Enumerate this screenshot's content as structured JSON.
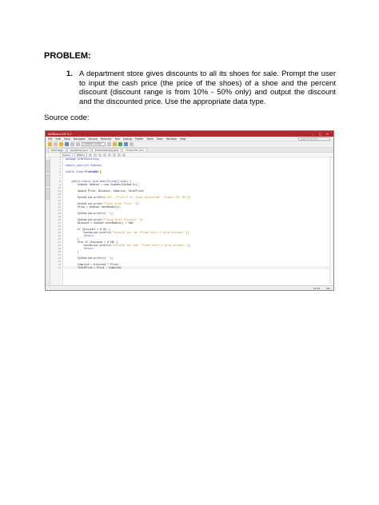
{
  "document": {
    "heading": "PROBLEM:",
    "problem_number": "1.",
    "problem_text": "A department store gives discounts to all its shoes for sale.  Prompt the user to input the cash price (the price of the shoes) of a shoe and the percent discount (discount range is from 10% - 50% only) and output the discount and the discounted price. Use the appropriate data type.",
    "source_label": "Source code:"
  },
  "ide": {
    "title": "NetBeans IDE 8.2",
    "window_buttons": [
      "–",
      "□",
      "✕"
    ],
    "menus": [
      "File",
      "Edit",
      "View",
      "Navigate",
      "Source",
      "Refactor",
      "Run",
      "Debug",
      "Profile",
      "Team",
      "Tools",
      "Window",
      "Help"
    ],
    "search_placeholder": "Search (Ctrl+I)",
    "config": "<default config>",
    "tabs": [
      "Start Page",
      "JavaShoes.java",
      "ProblemSolving.java",
      "ProblemNo.java"
    ],
    "editor_tabs": [
      "Source",
      "History"
    ],
    "side_tabs": [
      "Projects",
      "Files",
      "Services"
    ],
    "status": {
      "position": "40:35",
      "mode": "INS"
    },
    "line_numbers": [
      "1",
      "2",
      "3",
      "4",
      "5",
      "6",
      "7",
      "8",
      "9",
      "10",
      "11",
      "12",
      "13",
      "14",
      "15",
      "16",
      "17",
      "18",
      "19",
      "20",
      "21",
      "22",
      "23",
      "24",
      "25",
      "26",
      "27",
      "28",
      "29",
      "30",
      "31",
      "32",
      "33",
      "34",
      "35",
      "36",
      "37",
      "38",
      "39",
      "40",
      "41",
      "42",
      "43",
      "44"
    ],
    "code": {
      "l1": "package problemsolving;",
      "l3": "import java.util.Scanner;",
      "l5": "public class ",
      "l5b": "ProblemNo",
      "l8": "    public static void main(String[] args) {",
      "l9": "        Scanner AskUser = new Scanner(System.in);",
      "l11": "        double Price, Discount, Subprice, TotalPrice;",
      "l13a": "        System.out.println(",
      "l13b": "\"DPS - Price of All Shoes Discounted - Product ID: 101\"",
      "l13c": ");",
      "l15a": "        System.out.print(",
      "l15b": "\"Please enter Price: \"",
      "l15c": ");",
      "l16": "        Price = AskUser.nextDouble();",
      "l18a": "        System.out.println(",
      "l18b": "\" \"",
      "l18c": ");",
      "l20a": "        System.out.print(",
      "l20b": "\"Please enter Discount: \"",
      "l20c": ");",
      "l21": "        Discount = AskUser.nextDouble() / 100;",
      "l23": "        if (Discount < 0.10) {",
      "l24a": "            System.out.println(",
      "l24b": "\"Discount too low. Please enter a valid discount.\"",
      "l24c": ");",
      "l25": "            return;",
      "l26": "        }",
      "l27": "        else if (Discount > 0.50) {",
      "l28a": "            System.out.println(",
      "l28b": "\"Discount too high. Please enter a valid discount.\"",
      "l28c": ");",
      "l29": "            return;",
      "l30": "        }",
      "l32a": "        System.out.println(",
      "l32b": "\" \"",
      "l32c": ");",
      "l34": "        Subprice = Discount * Price;",
      "l35": "        TotalPrice = Price - Subprice;"
    }
  }
}
